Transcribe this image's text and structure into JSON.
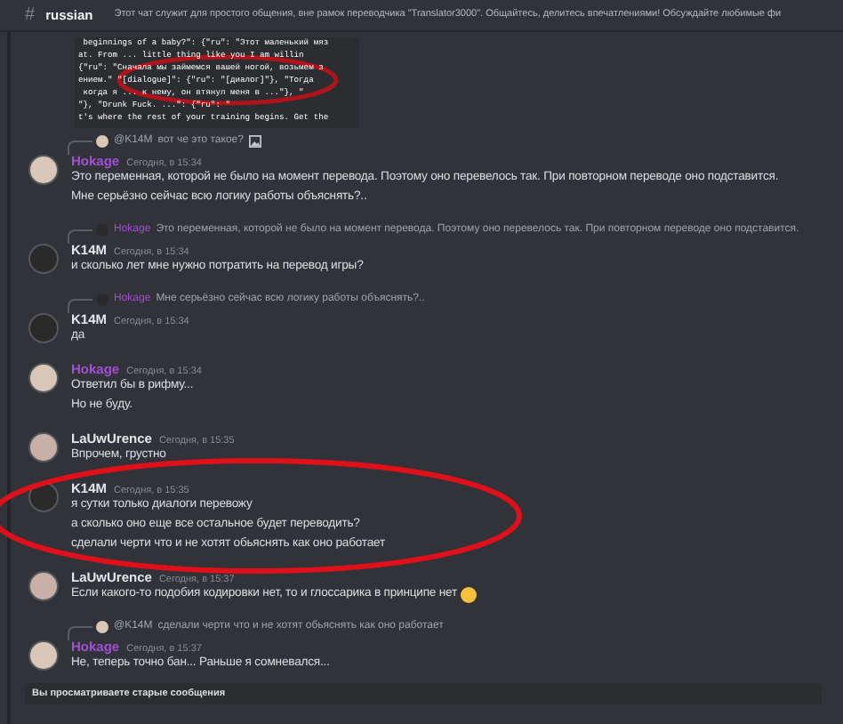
{
  "header": {
    "icon": "#",
    "channel": "russian",
    "topic": "Этот чат служит для простого общения, вне рамок переводчика \"Translator3000\". Общайтесь, делитесь впечатлениями! Обсуждайте любимые фи"
  },
  "code_block": {
    "lines": [
      " beginnings of a baby?\": {\"ru\": \"Этот маленький мяз",
      "at. From ... little thing like you I am willin",
      "{\"ru\": \"Сначала мы займемся вашей ногой, возьмем з",
      "ением.\" \"[dialogue]\": {\"ru\": \"[диалог]\"}, \"Тогда",
      " когда я ... к нему, он втянул меня в ...\"}, \"",
      "\"}, \"Drunk Fuck. ...\": {\"ru\": \"",
      "t's where the rest of your training begins. Get the"
    ]
  },
  "messages": [
    {
      "reply": {
        "author": "@K14M",
        "text": "вот че это такое?",
        "attachment": true
      },
      "author": "Hokage",
      "color": "#a34fd6",
      "time": "Сегодня, в 15:34",
      "lines": [
        "Это переменная, которой не было на момент перевода. Поэтому оно перевелось так. При повторном переводе оно подставится.",
        "Мне серьёзно сейчас всю логику работы объяснять?.."
      ],
      "circled": false
    },
    {
      "reply": {
        "author": "Hokage",
        "color": "#a34fd6",
        "text": "Это переменная, которой не было на момент перевода. Поэтому оно перевелось так. При повторном переводе оно подставится."
      },
      "author": "K14M",
      "color": "#e3e5e8",
      "time": "Сегодня, в 15:34",
      "lines": [
        "и сколько лет мне нужно потратить на перевод игры?"
      ],
      "circled": false
    },
    {
      "reply": {
        "author": "Hokage",
        "color": "#a34fd6",
        "text": "Мне серьёзно сейчас всю логику работы объяснять?.."
      },
      "author": "K14M",
      "color": "#e3e5e8",
      "time": "Сегодня, в 15:34",
      "lines": [
        "да"
      ],
      "circled": false
    },
    {
      "author": "Hokage",
      "color": "#a34fd6",
      "time": "Сегодня, в 15:34",
      "lines": [
        "Ответил бы в рифму...",
        "Но не буду."
      ],
      "circled": false
    },
    {
      "author": "LaUwUrence",
      "color": "#e3e5e8",
      "time": "Сегодня, в 15:35",
      "lines": [
        "Впрочем, грустно"
      ],
      "circled": false
    },
    {
      "author": "K14M",
      "color": "#e3e5e8",
      "time": "Сегодня, в 15:35",
      "lines": [
        "я сутки только диалоги перевожу",
        "а сколько оно еще все остальное будет переводить?",
        "сделали черти что и не хотят обьяснять как оно работает"
      ],
      "circled": true
    },
    {
      "author": "LaUwUrence",
      "color": "#e3e5e8",
      "time": "Сегодня, в 15:37",
      "lines": [
        "Если какого-то подобия кодировки нет, то и глоссарика в принципе нет"
      ],
      "emoji": true,
      "circled": false
    },
    {
      "reply": {
        "author": "@K14M",
        "text": "сделали черти что и не хотят обьяснять как оно работает"
      },
      "author": "Hokage",
      "color": "#a34fd6",
      "time": "Сегодня, в 15:37",
      "lines": [
        "Не, теперь точно бан... Раньше я сомневался..."
      ],
      "circled": false
    }
  ],
  "notice": "Вы просматриваете старые сообщения"
}
